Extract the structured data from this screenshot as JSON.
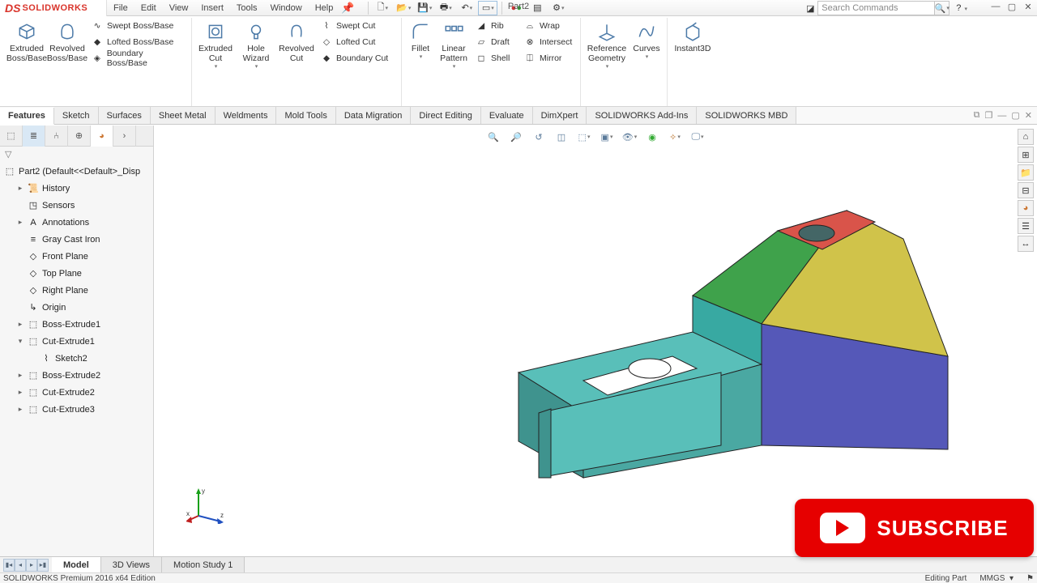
{
  "app": {
    "brand_prefix": "DS",
    "brand_name": "SOLIDWORKS",
    "doc_title": "Part2",
    "search_placeholder": "Search Commands"
  },
  "menu": [
    "File",
    "Edit",
    "View",
    "Insert",
    "Tools",
    "Window",
    "Help"
  ],
  "ribbon": {
    "g1": {
      "extruded": "Extruded\nBoss/Base",
      "revolved": "Revolved\nBoss/Base",
      "swept": "Swept Boss/Base",
      "lofted": "Lofted Boss/Base",
      "boundary": "Boundary Boss/Base"
    },
    "g2": {
      "extruded_cut": "Extruded\nCut",
      "hole": "Hole\nWizard",
      "revolved_cut": "Revolved\nCut",
      "swept_cut": "Swept Cut",
      "lofted_cut": "Lofted Cut",
      "boundary_cut": "Boundary Cut"
    },
    "g3": {
      "fillet": "Fillet",
      "linear": "Linear\nPattern",
      "rib": "Rib",
      "draft": "Draft",
      "shell": "Shell",
      "wrap": "Wrap",
      "intersect": "Intersect",
      "mirror": "Mirror"
    },
    "g4": {
      "refgeo": "Reference\nGeometry",
      "curves": "Curves"
    },
    "g5": {
      "instant3d": "Instant3D"
    }
  },
  "cm_tabs": [
    "Features",
    "Sketch",
    "Surfaces",
    "Sheet Metal",
    "Weldments",
    "Mold Tools",
    "Data Migration",
    "Direct Editing",
    "Evaluate",
    "DimXpert",
    "SOLIDWORKS Add-Ins",
    "SOLIDWORKS MBD"
  ],
  "tree": {
    "root": "Part2  (Default<<Default>_Disp",
    "items": [
      {
        "label": "History",
        "exp": "▸",
        "ico": "📜"
      },
      {
        "label": "Sensors",
        "exp": " ",
        "ico": "◳"
      },
      {
        "label": "Annotations",
        "exp": "▸",
        "ico": "A"
      },
      {
        "label": "Gray Cast Iron",
        "exp": " ",
        "ico": "≡"
      },
      {
        "label": "Front Plane",
        "exp": " ",
        "ico": "◇"
      },
      {
        "label": "Top Plane",
        "exp": " ",
        "ico": "◇"
      },
      {
        "label": "Right Plane",
        "exp": " ",
        "ico": "◇"
      },
      {
        "label": "Origin",
        "exp": " ",
        "ico": "↳"
      },
      {
        "label": "Boss-Extrude1",
        "exp": "▸",
        "ico": "⬚"
      },
      {
        "label": "Cut-Extrude1",
        "exp": "▾",
        "ico": "⬚"
      },
      {
        "label": "Sketch2",
        "exp": " ",
        "ico": "⌇",
        "indent": 2
      },
      {
        "label": "Boss-Extrude2",
        "exp": "▸",
        "ico": "⬚"
      },
      {
        "label": "Cut-Extrude2",
        "exp": "▸",
        "ico": "⬚"
      },
      {
        "label": "Cut-Extrude3",
        "exp": "▸",
        "ico": "⬚"
      }
    ]
  },
  "bottom_tabs": [
    "Model",
    "3D Views",
    "Motion Study 1"
  ],
  "status": {
    "left": "SOLIDWORKS Premium 2016 x64 Edition",
    "mode": "Editing Part",
    "units": "MMGS"
  },
  "subscribe": "SUBSCRIBE",
  "triad": {
    "x": "x",
    "y": "y",
    "z": "z"
  }
}
